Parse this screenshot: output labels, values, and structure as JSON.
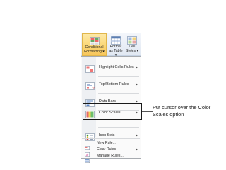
{
  "ribbon": {
    "buttons": [
      {
        "label": "Conditional\nFormatting ▾"
      },
      {
        "label": "Format\nas Table ▾"
      },
      {
        "label": "Cell\nStyles ▾"
      }
    ]
  },
  "menu": {
    "items": [
      {
        "label": "Highlight Cells Rules",
        "icon": "highlight-cells-icon",
        "submenu": true
      },
      {
        "label": "Top/Bottom Rules",
        "icon": "top-bottom-icon",
        "submenu": true
      },
      {
        "label": "Data Bars",
        "icon": "data-bars-icon",
        "submenu": true
      },
      {
        "label": "Color Scales",
        "icon": "color-scales-icon",
        "submenu": true
      },
      {
        "label": "Icon Sets",
        "icon": "icon-sets-icon",
        "submenu": true
      }
    ],
    "small_items": [
      {
        "label": "New Rule...",
        "icon": "new-rule-icon",
        "submenu": false
      },
      {
        "label": "Clear Rules",
        "icon": "clear-rules-icon",
        "submenu": true
      },
      {
        "label": "Manage Rules...",
        "icon": "manage-rules-icon",
        "submenu": false
      }
    ]
  },
  "callout": {
    "text": "Put cursor over the Color Scales option"
  },
  "colors": {
    "highlight": "#f7c55a",
    "menu_border": "#a7abb0",
    "frame": "#1a1a1a"
  }
}
